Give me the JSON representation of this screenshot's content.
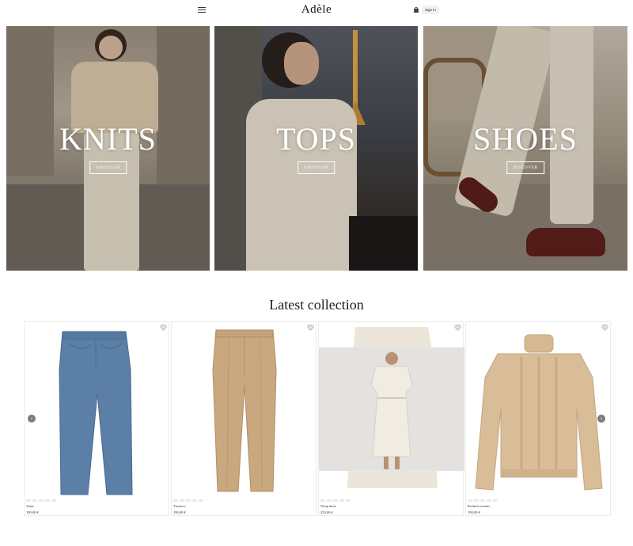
{
  "header": {
    "brand": "Adèle",
    "signin_label": "Sign in"
  },
  "heroes": [
    {
      "title": "KNITS",
      "button_label": "DISCOVER"
    },
    {
      "title": "TOPS",
      "button_label": "DISCOVER"
    },
    {
      "title": "SHOES",
      "button_label": "DISCOVER"
    }
  ],
  "collection": {
    "title": "Latest collection",
    "products": [
      {
        "name": "Jeans",
        "price": "190,00 €"
      },
      {
        "name": "Trousers",
        "price": "190,00 €"
      },
      {
        "name": "Wrap dress",
        "price": "250,00 €"
      },
      {
        "name": "Knitted sweater",
        "price": "190,00 €"
      }
    ]
  },
  "icons": {
    "menu": "hamburger-menu-icon",
    "cart": "shopping-bag-icon",
    "favorite": "heart-icon",
    "prev": "chevron-left-icon",
    "next": "chevron-right-icon"
  },
  "colors": {
    "hero_text": "#ffffff",
    "arrow_bg": "#7a7a7a",
    "denim": "#5b7fa6",
    "camel": "#c9a77f",
    "cream": "#ece6da",
    "knit": "#d9bd98"
  }
}
